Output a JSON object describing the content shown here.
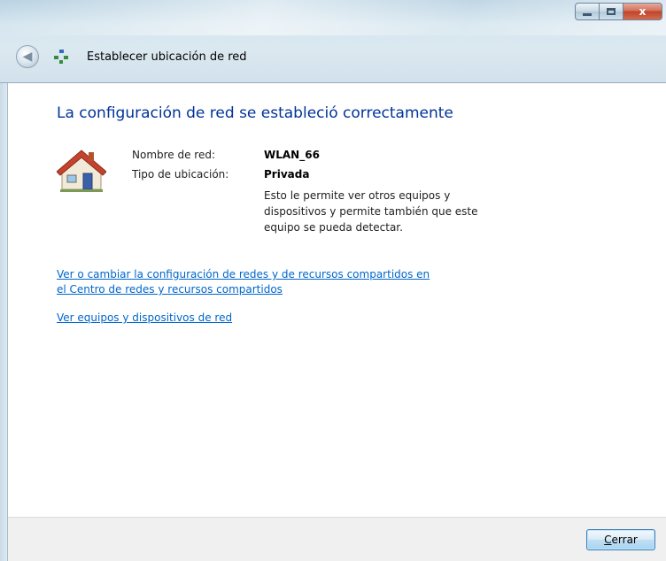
{
  "window": {
    "title": "Establecer ubicación de red",
    "controls": {
      "minimize": "minimize",
      "maximize": "maximize",
      "close": "x"
    }
  },
  "main": {
    "heading": "La configuración de red se estableció correctamente",
    "network_name_label": "Nombre de red:",
    "network_name_value": "WLAN_66",
    "location_type_label": "Tipo de ubicación:",
    "location_type_value": "Privada",
    "description": "Esto le permite ver otros equipos y dispositivos y permite también que este equipo se pueda detectar.",
    "link_network_center_line1": "Ver o cambiar la configuración de redes y de recursos compartidos en",
    "link_network_center_line2": "el Centro de redes y recursos compartidos",
    "link_view_devices": "Ver equipos y dispositivos de red"
  },
  "footer": {
    "close_button_accel": "C",
    "close_button_rest": "errar"
  },
  "icons": {
    "back": "back-arrow-icon",
    "network": "network-icon",
    "house": "house-icon"
  },
  "colors": {
    "heading": "#003399",
    "link": "#0066cc",
    "close_button_red": "#c04428"
  }
}
